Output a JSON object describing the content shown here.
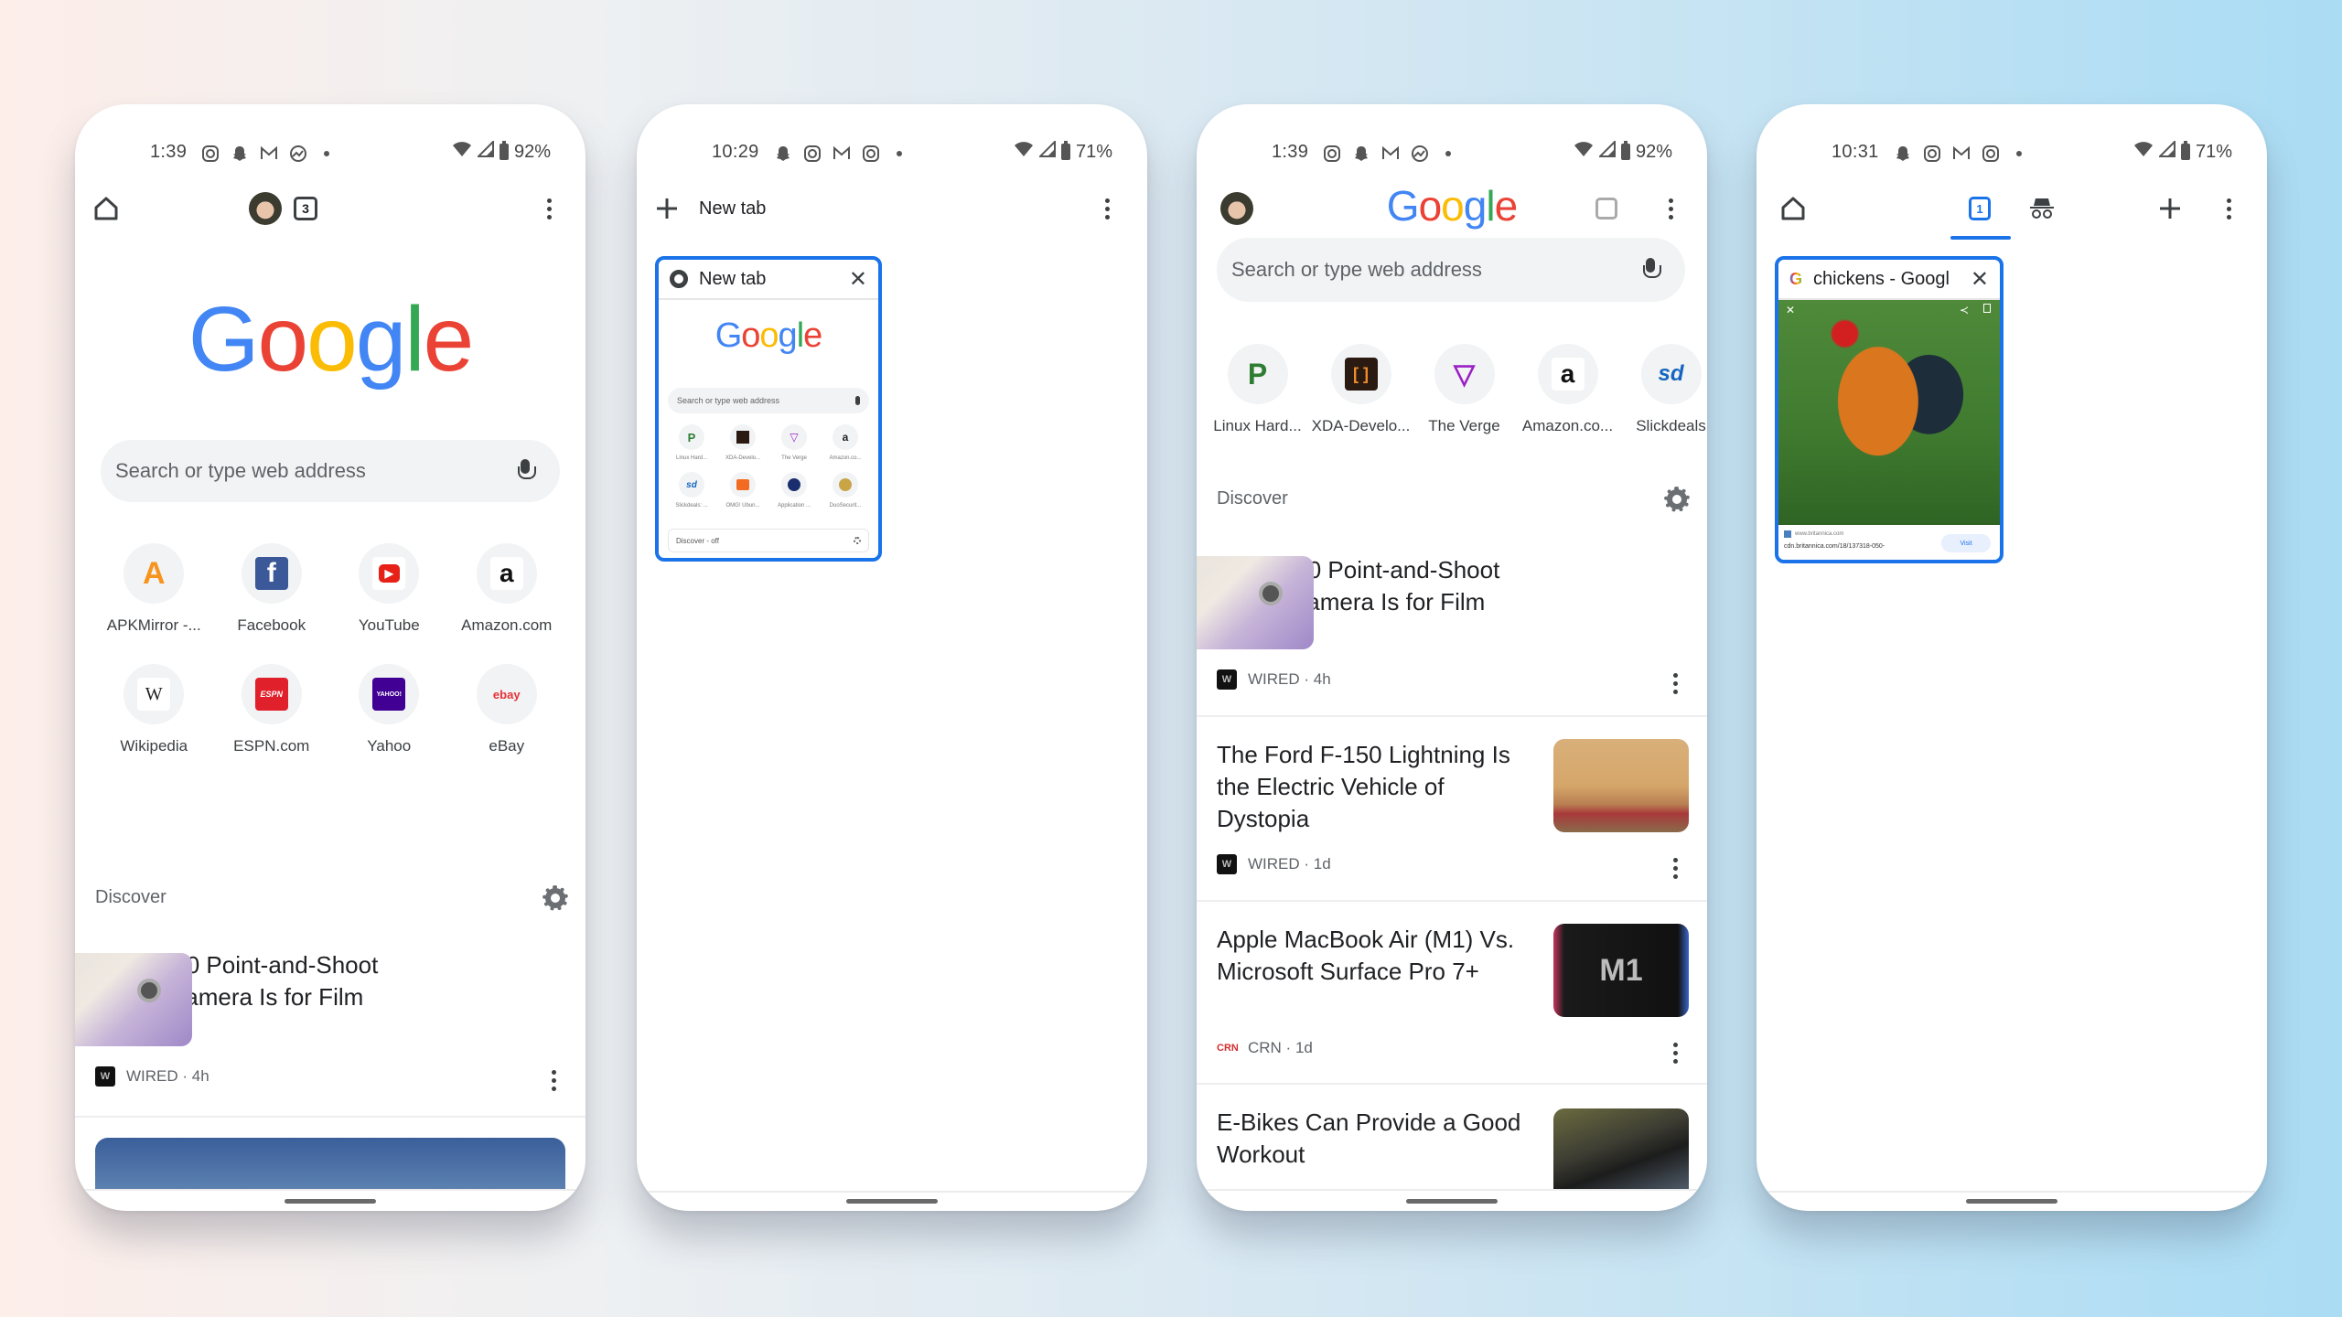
{
  "accent_color": "#1a73e8",
  "phones": [
    {
      "status": {
        "time": "1:39",
        "battery": "92%",
        "notif_icons": [
          "instagram-icon",
          "snapchat-icon",
          "gmail-icon",
          "basecamp-icon"
        ]
      },
      "toolbar": {
        "tab_count": "3"
      },
      "logo": {
        "G": "G",
        "o1": "o",
        "o2": "o",
        "g": "g",
        "l": "l",
        "e": "e"
      },
      "search": {
        "placeholder": "Search or type web address"
      },
      "shortcuts": [
        {
          "label": "APKMirror -...",
          "glyph": "A"
        },
        {
          "label": "Facebook",
          "glyph": "f"
        },
        {
          "label": "YouTube",
          "glyph": "▶"
        },
        {
          "label": "Amazon.com",
          "glyph": "a"
        },
        {
          "label": "Wikipedia",
          "glyph": "W"
        },
        {
          "label": "ESPN.com",
          "glyph": "ESPN"
        },
        {
          "label": "Yahoo",
          "glyph": "YAHOO!"
        },
        {
          "label": "eBay",
          "glyph": "ebay"
        }
      ],
      "discover": {
        "label": "Discover"
      },
      "articles": [
        {
          "title": "This $120 Point-and-Shoot Digital Camera Is for Film Lovers",
          "source": "WIRED · 4h",
          "logo": "W"
        }
      ]
    },
    {
      "status": {
        "time": "10:29",
        "battery": "71%",
        "notif_icons": [
          "snapchat-icon",
          "instagram-icon",
          "gmail-icon",
          "instagram-icon"
        ]
      },
      "toolbar": {
        "new_tab_label": "New tab"
      },
      "tab_card": {
        "title": "New tab",
        "preview": {
          "search_placeholder": "Search or type web address",
          "shortcuts": [
            "Linux Hard...",
            "XDA-Develo...",
            "The Verge",
            "Amazon.co...",
            "Slickdeals: ...",
            "OMG! Ubun...",
            "Application ...",
            "DuoSecurit..."
          ],
          "discover_label": "Discover - off"
        }
      }
    },
    {
      "status": {
        "time": "1:39",
        "battery": "92%",
        "notif_icons": [
          "instagram-icon",
          "snapchat-icon",
          "gmail-icon",
          "basecamp-icon"
        ]
      },
      "search": {
        "placeholder": "Search or type web address"
      },
      "shortcuts": [
        {
          "label": "Linux Hard...",
          "glyph": "P"
        },
        {
          "label": "XDA-Develo...",
          "glyph": "[ ]"
        },
        {
          "label": "The Verge",
          "glyph": "▽"
        },
        {
          "label": "Amazon.co...",
          "glyph": "a"
        },
        {
          "label": "Slickdeals",
          "glyph": "sd"
        }
      ],
      "discover": {
        "label": "Discover"
      },
      "articles": [
        {
          "title": "This $120 Point-and-Shoot Digital Camera Is for Film Lovers",
          "source": "WIRED · 4h",
          "logo": "W"
        },
        {
          "title": "The Ford F-150 Lightning Is the Electric Vehicle of Dystopia",
          "source": "WIRED · 1d",
          "logo": "W"
        },
        {
          "title": "Apple MacBook Air (M1) Vs. Microsoft Surface Pro 7+",
          "source": "CRN · 1d",
          "logo": "CRN",
          "thumb_text": "M1"
        },
        {
          "title": "E-Bikes Can Provide a Good Workout"
        }
      ]
    },
    {
      "status": {
        "time": "10:31",
        "battery": "71%",
        "notif_icons": [
          "snapchat-icon",
          "instagram-icon",
          "gmail-icon",
          "instagram-icon"
        ]
      },
      "toolbar": {
        "tab_count": "1"
      },
      "tab_card": {
        "title": "chickens - Googl",
        "preview": {
          "site": "www.britannica.com",
          "url": "cdn.britannica.com/18/137318-050-",
          "visit_label": "Visit"
        }
      }
    }
  ]
}
